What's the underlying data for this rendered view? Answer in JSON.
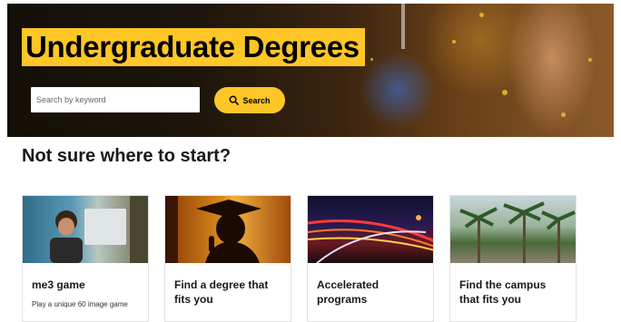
{
  "hero": {
    "title": "Undergraduate Degrees",
    "search_placeholder": "Search by keyword",
    "search_button": "Search"
  },
  "section_title": "Not sure where to start?",
  "cards": [
    {
      "title": "me3 game",
      "description": "Play a unique 60 image game"
    },
    {
      "title": "Find a degree that fits you",
      "description": ""
    },
    {
      "title": "Accelerated programs",
      "description": ""
    },
    {
      "title": "Find the campus that fits you",
      "description": ""
    }
  ],
  "colors": {
    "accent": "#ffc627",
    "text": "#191919"
  }
}
